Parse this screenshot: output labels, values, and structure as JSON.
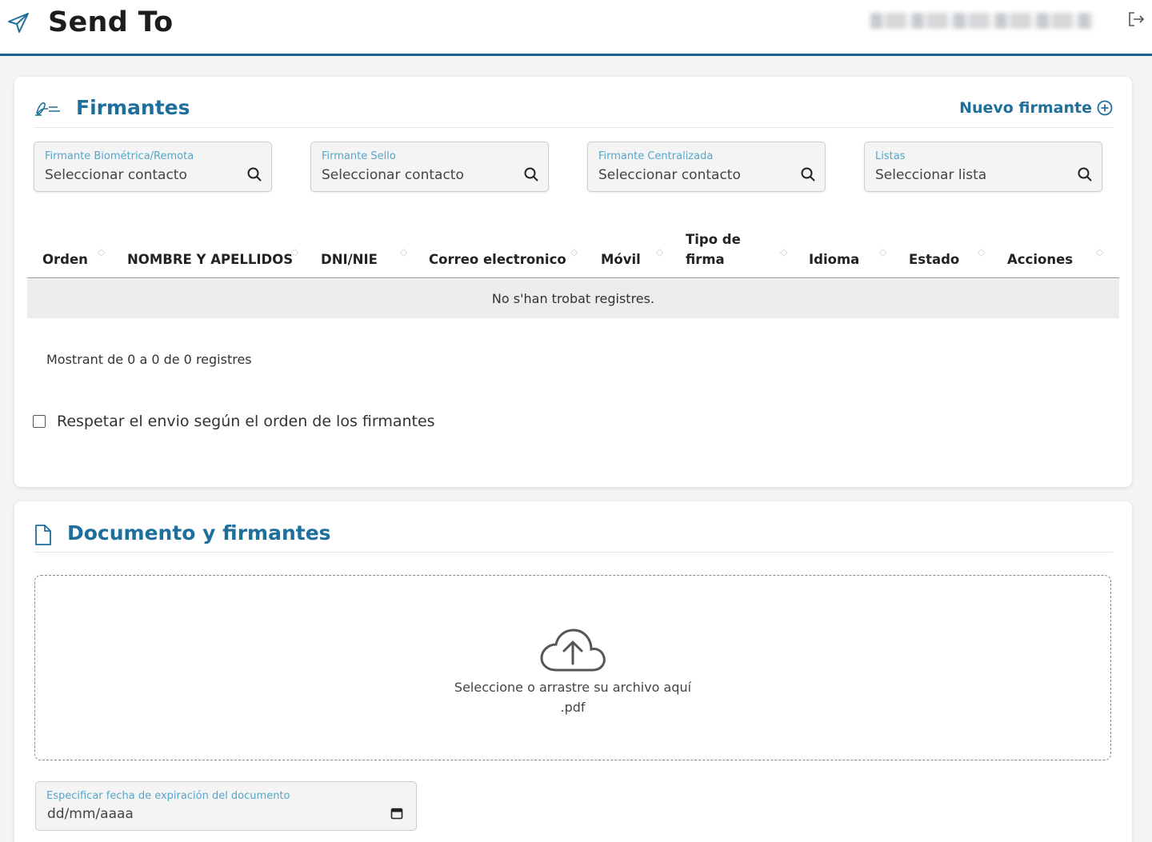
{
  "header": {
    "title": "Send To",
    "icons": {
      "app": "paper-plane-icon",
      "logout": "logout-icon"
    }
  },
  "firmantes": {
    "title": "Firmantes",
    "icon": "signature-icon",
    "new_button": "Nuevo firmante",
    "fields": [
      {
        "label": "Firmante Biométrica/Remota",
        "placeholder": "Seleccionar contacto"
      },
      {
        "label": "Firmante Sello",
        "placeholder": "Seleccionar contacto"
      },
      {
        "label": "Firmante Centralizada",
        "placeholder": "Seleccionar contacto"
      },
      {
        "label": "Listas",
        "placeholder": "Seleccionar lista"
      }
    ],
    "table": {
      "columns": [
        "Orden",
        "NOMBRE Y APELLIDOS",
        "DNI/NIE",
        "Correo electronico",
        "Móvil",
        "Tipo de",
        "firma",
        "Idioma",
        "Estado",
        "Acciones"
      ],
      "empty_message": "No s'han trobat registres.",
      "info": "Mostrant de 0 a 0 de 0 registres"
    },
    "order_checkbox_label": "Respetar el envio según el orden de los firmantes"
  },
  "documento": {
    "title": "Documento y firmantes",
    "icon": "document-icon",
    "dropzone": {
      "text": "Seleccione o arrastre su archivo aquí",
      "ext": ".pdf",
      "icon": "cloud-upload-icon"
    },
    "expiry": {
      "label": "Especificar fecha de expiración del documento",
      "placeholder": "dd/mm/aaaa"
    }
  },
  "colors": {
    "accent": "#1f6f9c",
    "label": "#56a6c9",
    "header_border": "#1f5f8b"
  }
}
